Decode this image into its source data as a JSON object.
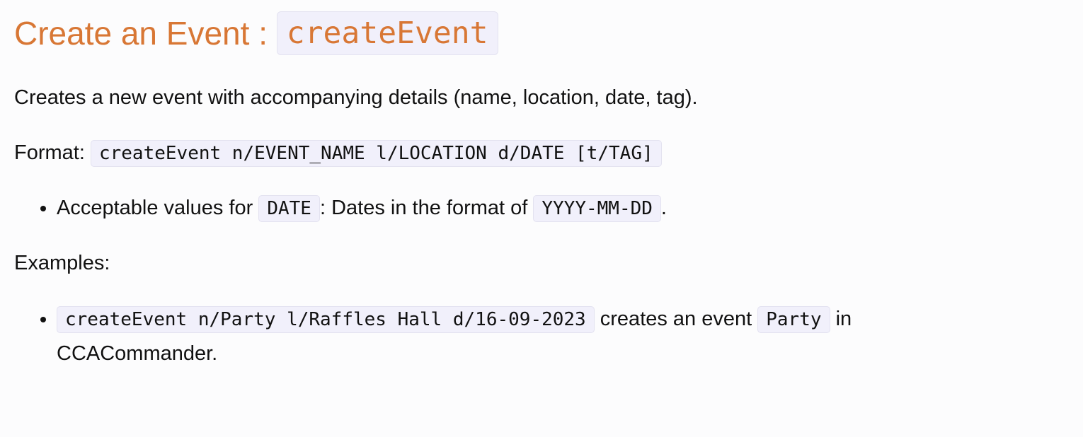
{
  "heading": {
    "text": "Create an Event : ",
    "code": "createEvent"
  },
  "description": "Creates a new event with accompanying details (name, location, date, tag).",
  "format": {
    "label": "Format: ",
    "code": "createEvent n/EVENT_NAME l/LOCATION d/DATE [t/TAG]"
  },
  "acceptable": {
    "prefix": "Acceptable values for ",
    "code1": "DATE",
    "middle": ": Dates in the format of ",
    "code2": "YYYY-MM-DD",
    "suffix": "."
  },
  "examples_label": "Examples:",
  "example": {
    "code": "createEvent n/Party l/Raffles Hall d/16-09-2023",
    "text1": " creates an event ",
    "code2": "Party",
    "text2": " in CCACommander."
  },
  "colors": {
    "heading": "#d87735",
    "code_background": "#f1f0fb",
    "page_background": "#fcfcfd"
  }
}
